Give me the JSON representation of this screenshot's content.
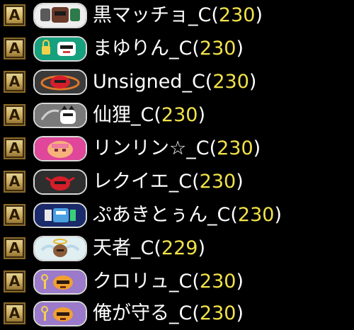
{
  "members": [
    {
      "name": "黒マッチョ_C",
      "level": "230",
      "badge": {
        "color": "#eeeeee",
        "icon": "muscle-emblem-icon"
      }
    },
    {
      "name": "まゆりん_C",
      "level": "230",
      "badge": {
        "color": "#16a07e",
        "icon": "lock-face-emblem-icon"
      }
    },
    {
      "name": "Unsigned_C",
      "level": "230",
      "badge": {
        "color": "#3a3a3a",
        "icon": "red-mask-emblem-icon"
      }
    },
    {
      "name": "仙狸_C",
      "level": "230",
      "badge": {
        "color": "#7a7a7a",
        "icon": "cat-face-emblem-icon"
      }
    },
    {
      "name": "リンリン☆_C",
      "level": "230",
      "badge": {
        "color": "#e0469a",
        "icon": "pink-face-emblem-icon"
      }
    },
    {
      "name": "レクイエ_C",
      "level": "230",
      "badge": {
        "color": "#2e2e2e",
        "icon": "red-mask-emblem-icon"
      }
    },
    {
      "name": "ぷあきとぅん_C",
      "level": "230",
      "badge": {
        "color": "#1a2a6a",
        "icon": "blue-crest-emblem-icon"
      }
    },
    {
      "name": "天者_C",
      "level": "229",
      "badge": {
        "color": "#dfeff2",
        "icon": "angel-emblem-icon"
      }
    },
    {
      "name": "クロリュ_C",
      "level": "230",
      "badge": {
        "color": "#9b7acb",
        "icon": "key-mask-emblem-icon"
      }
    },
    {
      "name": "俺が守る_C",
      "level": "230",
      "badge": {
        "color": "#9b7acb",
        "icon": "key-mask-emblem-icon"
      }
    }
  ],
  "rank_glyph": "A",
  "level_open": "(",
  "level_close": ")"
}
